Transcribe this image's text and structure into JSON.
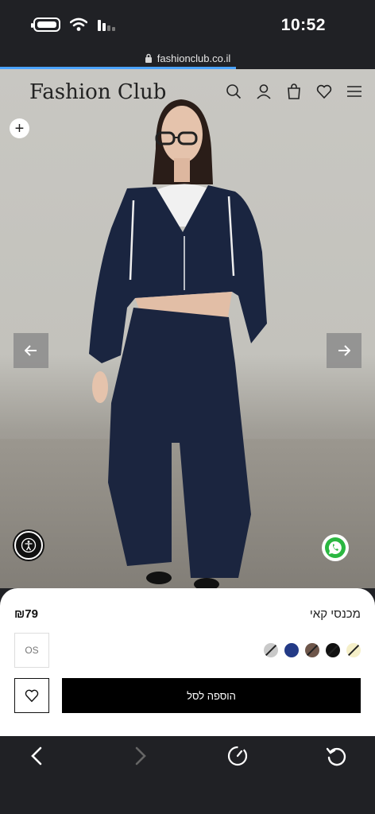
{
  "status_bar": {
    "time": "10:52"
  },
  "browser": {
    "url": "fashionclub.co.il",
    "load_progress_percent": 63
  },
  "site": {
    "logo": "Fashion Club"
  },
  "product": {
    "price": "₪79",
    "name": "מכנסי קאי",
    "size": "OS",
    "add_to_cart_label": "הוספה לסל",
    "colors": [
      "#c9c9c9",
      "#233a86",
      "#6e564a",
      "#111111",
      "#f5efc8"
    ],
    "unavailable_colors": [
      0,
      2,
      3,
      4
    ]
  },
  "icons": {
    "header": [
      "search-icon",
      "user-icon",
      "bag-icon",
      "heart-icon",
      "menu-icon"
    ],
    "hero": [
      "plus-icon",
      "arrow-left-icon",
      "arrow-right-icon",
      "accessibility-icon",
      "whatsapp-icon"
    ],
    "nav": [
      "back-icon",
      "forward-icon",
      "tabs-icon",
      "reload-icon"
    ]
  }
}
